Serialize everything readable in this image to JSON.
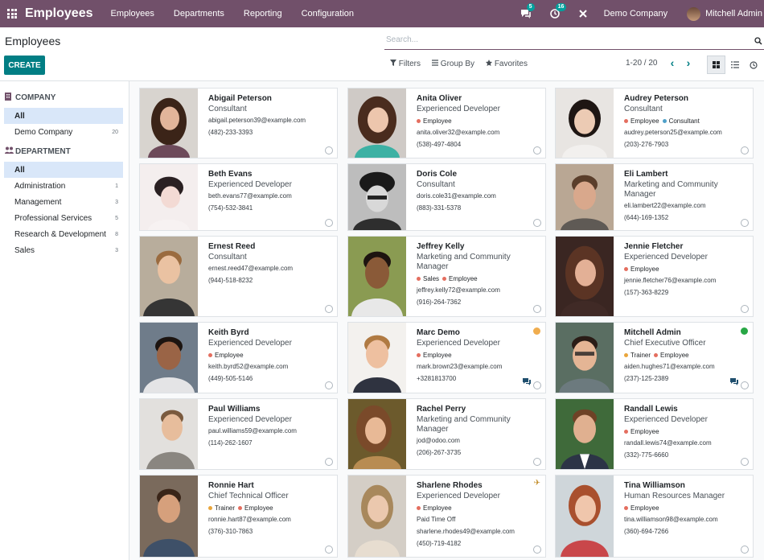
{
  "topbar": {
    "app": "Employees",
    "menus": [
      "Employees",
      "Departments",
      "Reporting",
      "Configuration"
    ],
    "msg_count": "5",
    "activity_count": "16",
    "company": "Demo Company",
    "user": "Mitchell Admin"
  },
  "control": {
    "title": "Employees",
    "create": "CREATE",
    "search_placeholder": "Search...",
    "filters": "Filters",
    "group_by": "Group By",
    "favorites": "Favorites",
    "pager": "1-20 / 20"
  },
  "sidebar": {
    "company_header": "COMPANY",
    "company_items": [
      {
        "label": "All",
        "count": ""
      },
      {
        "label": "Demo Company",
        "count": "20"
      }
    ],
    "dept_header": "DEPARTMENT",
    "dept_items": [
      {
        "label": "All",
        "count": ""
      },
      {
        "label": "Administration",
        "count": "1"
      },
      {
        "label": "Management",
        "count": "3"
      },
      {
        "label": "Professional Services",
        "count": "5"
      },
      {
        "label": "Research & Development",
        "count": "8"
      },
      {
        "label": "Sales",
        "count": "3"
      }
    ]
  },
  "colors": {
    "accent": "#71506a",
    "primary": "#017e84",
    "tag_employee": "#e46e5f",
    "tag_consultant": "#4fa0c9",
    "tag_trainer": "#e9a53b",
    "tag_sales": "#e46e5f",
    "status_away": "#f0ad4e",
    "status_online": "#28a745"
  },
  "employees": [
    {
      "name": "Abigail Peterson",
      "job": "Consultant",
      "email": "abigail.peterson39@example.com",
      "phone": "(482)-233-3393"
    },
    {
      "name": "Anita Oliver",
      "job": "Experienced Developer",
      "tag1": "Employee",
      "email": "anita.oliver32@example.com",
      "phone": "(538)-497-4804"
    },
    {
      "name": "Audrey Peterson",
      "job": "Consultant",
      "tag1": "Employee",
      "tag2": "Consultant",
      "email": "audrey.peterson25@example.com",
      "phone": "(203)-276-7903"
    },
    {
      "name": "Beth Evans",
      "job": "Experienced Developer",
      "email": "beth.evans77@example.com",
      "phone": "(754)-532-3841"
    },
    {
      "name": "Doris Cole",
      "job": "Consultant",
      "email": "doris.cole31@example.com",
      "phone": "(883)-331-5378"
    },
    {
      "name": "Eli Lambert",
      "job": "Marketing and Community Manager",
      "email": "eli.lambert22@example.com",
      "phone": "(644)-169-1352"
    },
    {
      "name": "Ernest Reed",
      "job": "Consultant",
      "email": "ernest.reed47@example.com",
      "phone": "(944)-518-8232"
    },
    {
      "name": "Jeffrey Kelly",
      "job": "Marketing and Community Manager",
      "tag1": "Sales",
      "tag2": "Employee",
      "email": "jeffrey.kelly72@example.com",
      "phone": "(916)-264-7362"
    },
    {
      "name": "Jennie Fletcher",
      "job": "Experienced Developer",
      "tag1": "Employee",
      "email": "jennie.fletcher76@example.com",
      "phone": "(157)-363-8229"
    },
    {
      "name": "Keith Byrd",
      "job": "Experienced Developer",
      "tag1": "Employee",
      "email": "keith.byrd52@example.com",
      "phone": "(449)-505-5146"
    },
    {
      "name": "Marc Demo",
      "job": "Experienced Developer",
      "tag1": "Employee",
      "email": "mark.brown23@example.com",
      "phone": "+3281813700"
    },
    {
      "name": "Mitchell Admin",
      "job": "Chief Executive Officer",
      "tag1": "Trainer",
      "tag2": "Employee",
      "email": "aiden.hughes71@example.com",
      "phone": "(237)-125-2389"
    },
    {
      "name": "Paul Williams",
      "job": "Experienced Developer",
      "email": "paul.williams59@example.com",
      "phone": "(114)-262-1607"
    },
    {
      "name": "Rachel Perry",
      "job": "Marketing and Community Manager",
      "email": "jod@odoo.com",
      "phone": "(206)-267-3735"
    },
    {
      "name": "Randall Lewis",
      "job": "Experienced Developer",
      "tag1": "Employee",
      "email": "randall.lewis74@example.com",
      "phone": "(332)-775-6660"
    },
    {
      "name": "Ronnie Hart",
      "job": "Chief Technical Officer",
      "tag1": "Trainer",
      "tag2": "Employee",
      "email": "ronnie.hart87@example.com",
      "phone": "(376)-310-7863"
    },
    {
      "name": "Sharlene Rhodes",
      "job": "Experienced Developer",
      "tag1": "Employee",
      "extra": "Paid Time Off",
      "email": "sharlene.rhodes49@example.com",
      "phone": "(450)-719-4182"
    },
    {
      "name": "Tina Williamson",
      "job": "Human Resources Manager",
      "tag1": "Employee",
      "email": "tina.williamson98@example.com",
      "phone": "(360)-694-7266"
    }
  ]
}
